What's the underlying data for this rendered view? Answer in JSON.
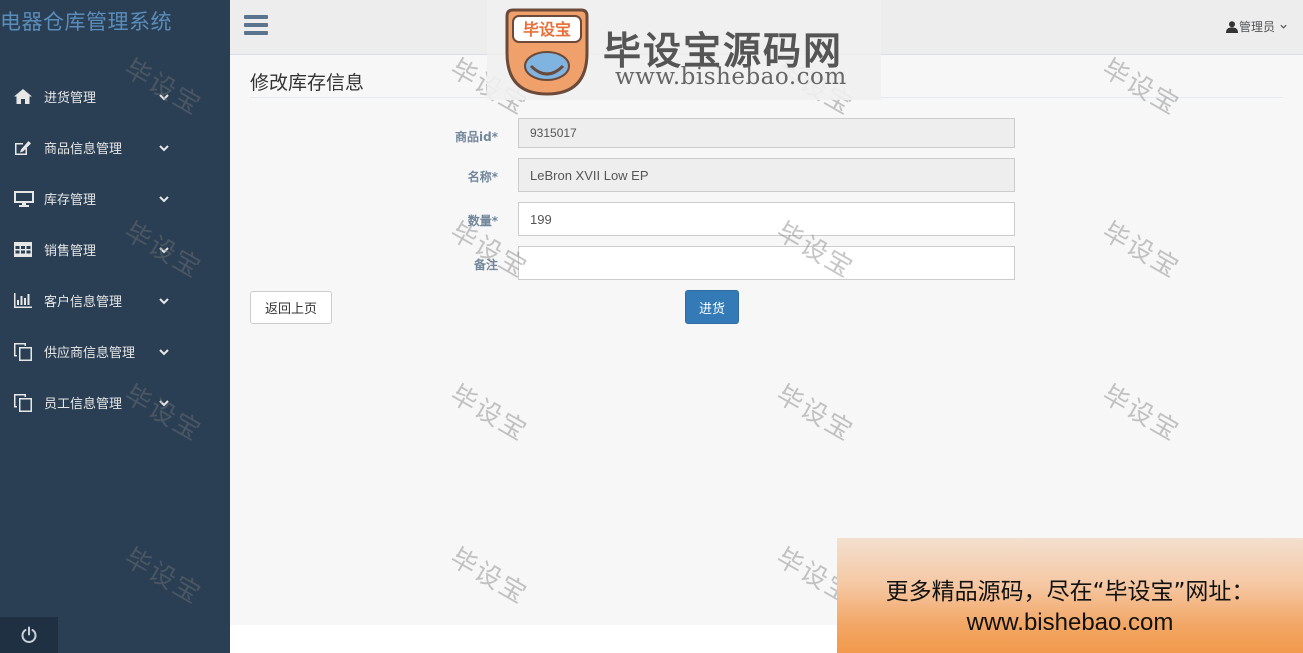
{
  "app": {
    "title": "电器仓库管理系统"
  },
  "sidebar": {
    "items": [
      {
        "label": "进货管理",
        "icon": "home-icon"
      },
      {
        "label": "商品信息管理",
        "icon": "edit-icon"
      },
      {
        "label": "库存管理",
        "icon": "monitor-icon"
      },
      {
        "label": "销售管理",
        "icon": "table-icon"
      },
      {
        "label": "客户信息管理",
        "icon": "bar-chart-icon"
      },
      {
        "label": "供应商信息管理",
        "icon": "copy-icon"
      },
      {
        "label": "员工信息管理",
        "icon": "copy-icon"
      }
    ],
    "footer_icon": "power-icon"
  },
  "header": {
    "menu_icon": "hamburger-icon",
    "user_label": "管理员"
  },
  "page": {
    "title": "修改库存信息",
    "form": {
      "product_id": {
        "label": "商品id*",
        "value": "9315017"
      },
      "name": {
        "label": "名称*",
        "value": "LeBron XVII Low EP"
      },
      "quantity": {
        "label": "数量*",
        "value": "199"
      },
      "remark": {
        "label": "备注",
        "value": ""
      }
    },
    "back_button": "返回上页",
    "submit_button": "进货"
  },
  "watermark": {
    "text": "毕设宝",
    "logo_badge_text": "毕设宝",
    "logo_title": "毕设宝源码网",
    "logo_url": "www.bishebao.com"
  },
  "ad": {
    "line1": "更多精品源码，尽在“毕设宝”网址：",
    "line2": "www.bishebao.com"
  },
  "colors": {
    "sidebar_bg": "#2a3f54",
    "app_title": "#5a8dbb",
    "primary_button": "#337ab7",
    "form_label": "#73879c"
  }
}
